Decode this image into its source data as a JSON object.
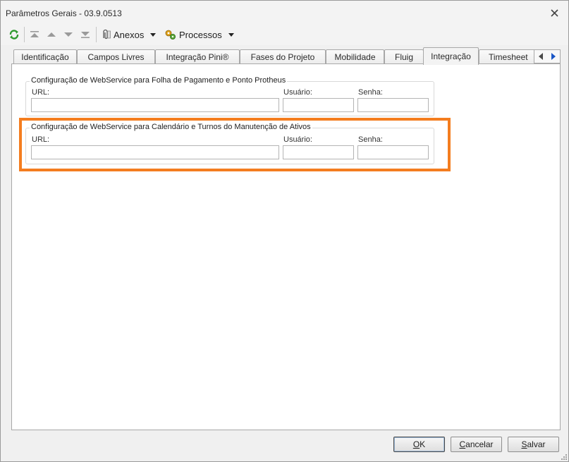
{
  "window": {
    "title": "Parâmetros Gerais - 03.9.0513"
  },
  "toolbar": {
    "anexos_label": "Anexos",
    "processos_label": "Processos"
  },
  "tabs": [
    {
      "label": "Identificação"
    },
    {
      "label": "Campos Livres"
    },
    {
      "label": "Integração Pini®"
    },
    {
      "label": "Fases do Projeto"
    },
    {
      "label": "Mobilidade"
    },
    {
      "label": "Fluig"
    },
    {
      "label": "Integração"
    },
    {
      "label": "Timesheet"
    }
  ],
  "active_tab": "Integração",
  "groups": [
    {
      "title": "Configuração de WebService para Folha de Pagamento e Ponto Protheus",
      "url_label": "URL:",
      "url_value": "",
      "user_label": "Usuário:",
      "user_value": "",
      "password_label": "Senha:",
      "password_value": ""
    },
    {
      "title": "Configuração de WebService para Calendário e Turnos do Manutenção de Ativos",
      "url_label": "URL:",
      "url_value": "",
      "user_label": "Usuário:",
      "user_value": "",
      "password_label": "Senha:",
      "password_value": ""
    }
  ],
  "buttons": {
    "ok_first": "O",
    "ok_rest": "K",
    "cancel_first": "C",
    "cancel_rest": "ancelar",
    "save_first": "S",
    "save_rest": "alvar"
  },
  "colors": {
    "highlight": "#f47d1f",
    "refresh_icon": "#2e9a2e"
  }
}
